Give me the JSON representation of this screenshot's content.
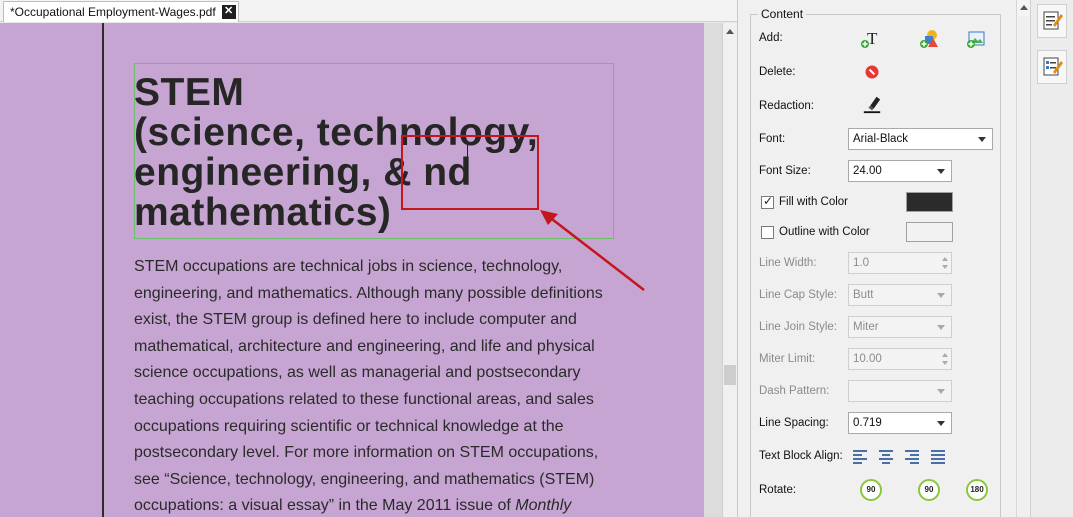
{
  "tab": {
    "title": "*Occupational Employment-Wages.pdf",
    "close": "✕"
  },
  "document": {
    "heading_lines": [
      "STEM",
      "(science, technology,",
      "engineering, & nd",
      "mathematics)"
    ],
    "body_lines": [
      "STEM occupations are technical jobs in science, technology,",
      "engineering, and mathematics. Although many possible definitions",
      "exist, the STEM group is defined here to include computer and",
      "mathematical, architecture and engineering, and life and physical",
      "science occupations, as well as managerial and postsecondary",
      "teaching occupations related to these functional areas, and sales",
      "occupations requiring scientific or technical knowledge at the",
      "postsecondary level. For more information on STEM occupations,",
      "see “Science, technology, engineering, and mathematics (STEM)",
      "occupations: a visual essay” in the May 2011 issue of "
    ],
    "body_last_italic": "Monthly",
    "page_color": "#c6a5d2",
    "annotation_color": "#c4161c"
  },
  "panel": {
    "group_title": "Content",
    "add_label": "Add:",
    "delete_label": "Delete:",
    "redaction_label": "Redaction:",
    "font_label": "Font:",
    "font_value": "Arial-Black",
    "font_size_label": "Font Size:",
    "font_size_value": "24.00",
    "fill_label": "Fill with Color",
    "fill_checked": true,
    "fill_color": "#2b2b2b",
    "outline_label": "Outline with Color",
    "outline_checked": false,
    "outline_color": "#f2f2f2",
    "line_width_label": "Line Width:",
    "line_width_value": "1.0",
    "line_cap_label": "Line Cap Style:",
    "line_cap_value": "Butt",
    "line_join_label": "Line Join Style:",
    "line_join_value": "Miter",
    "miter_label": "Miter Limit:",
    "miter_value": "10.00",
    "dash_label": "Dash Pattern:",
    "dash_value": "",
    "line_spacing_label": "Line Spacing:",
    "line_spacing_value": "0.719",
    "text_align_label": "Text Block Align:",
    "rotate_label": "Rotate:",
    "rotate_values": [
      "90",
      "90",
      "180"
    ]
  }
}
